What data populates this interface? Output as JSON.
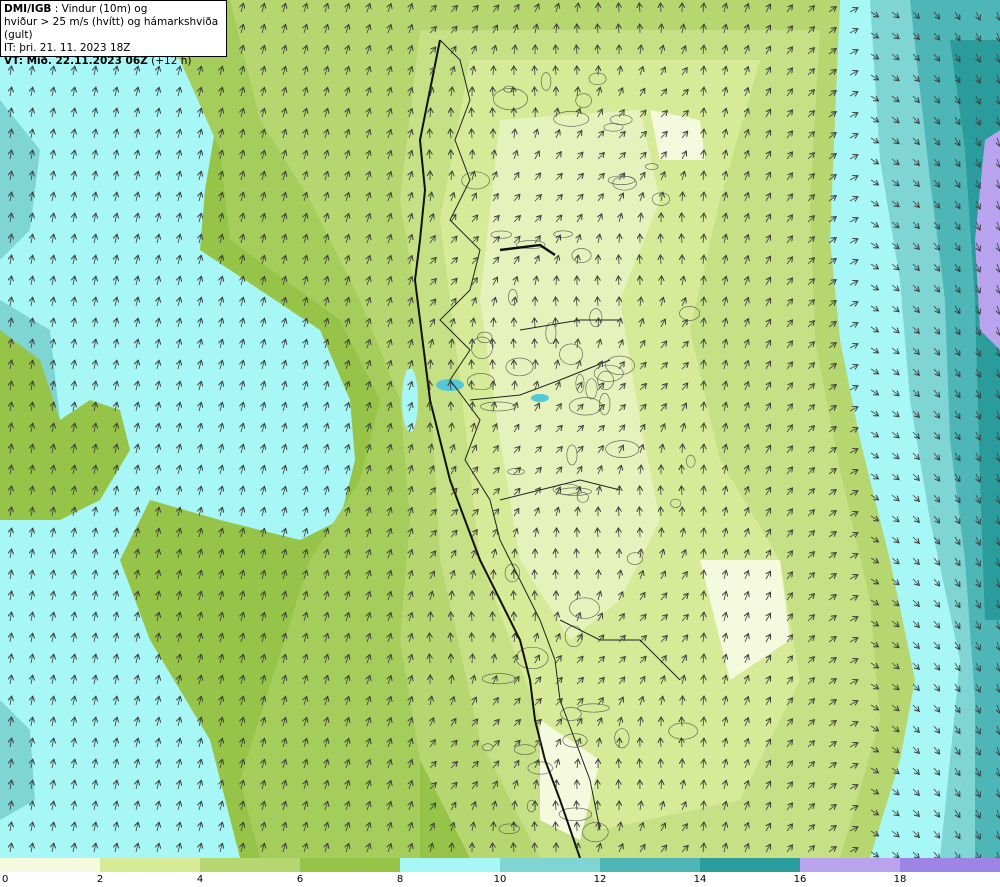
{
  "header": {
    "source": "DMI/IGB",
    "line1_rest": " : Vindur (10m) og",
    "line2": "hviður > 25 m/s (hvítt) og hámarkshviða (gult)",
    "line3": "IT: þri. 21. 11. 2023 18Z",
    "valid_label": "VT: Mið. 22.11.2023 06Z",
    "valid_offset": " (+12 h)"
  },
  "legend": {
    "colors": [
      "#f5fadf",
      "#d6ea97",
      "#b6d770",
      "#96c448",
      "#a8f7f7",
      "#7fd4d4",
      "#4eb6b6",
      "#2b9c9c",
      "#b9a3ef",
      "#9f84e6"
    ],
    "ticks": [
      {
        "value": "0"
      },
      {
        "value": "2"
      },
      {
        "value": "4"
      },
      {
        "value": "6"
      },
      {
        "value": "8"
      },
      {
        "value": "10"
      },
      {
        "value": "12"
      },
      {
        "value": "14"
      },
      {
        "value": "16"
      },
      {
        "value": "18"
      }
    ]
  },
  "map": {
    "palette": {
      "sea_light": "#a8f7f7",
      "sea_mid": "#7fd4d4",
      "sea_dark": "#4eb6b6",
      "sea_deep": "#2b9c9c",
      "purple": "#b9a3ef",
      "green_dark": "#96c448",
      "green_mid": "#b6d770",
      "green_light": "#d6ea97",
      "green_pale": "#f5fadf",
      "lake": "#54c7d8",
      "arrow": "#3c3c3c",
      "coast": "#111111"
    },
    "wind_arrow": "wind-direction-arrow"
  }
}
